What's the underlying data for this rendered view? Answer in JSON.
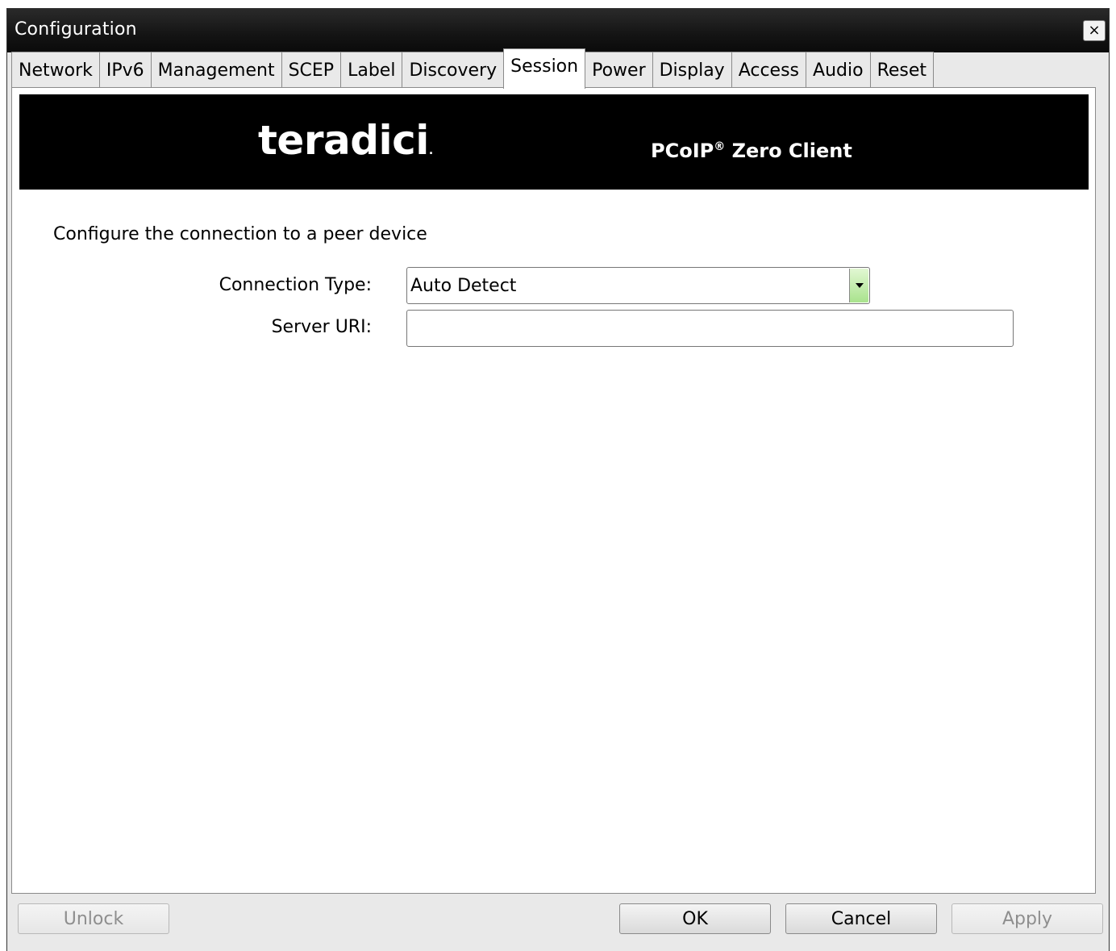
{
  "window": {
    "title": "Configuration",
    "close_glyph": "×"
  },
  "tabs": [
    {
      "label": "Network"
    },
    {
      "label": "IPv6"
    },
    {
      "label": "Management"
    },
    {
      "label": "SCEP"
    },
    {
      "label": "Label"
    },
    {
      "label": "Discovery"
    },
    {
      "label": "Session",
      "active": true
    },
    {
      "label": "Power"
    },
    {
      "label": "Display"
    },
    {
      "label": "Access"
    },
    {
      "label": "Audio"
    },
    {
      "label": "Reset"
    }
  ],
  "banner": {
    "logo_text": "teradici",
    "logo_dot": ".",
    "product_prefix": "PCoIP",
    "product_mark": "®",
    "product_suffix": " Zero Client"
  },
  "session": {
    "description": "Configure the connection to a peer device",
    "connection_type_label": "Connection Type:",
    "connection_type_value": "Auto Detect",
    "server_uri_label": "Server URI:",
    "server_uri_value": ""
  },
  "buttons": {
    "unlock": "Unlock",
    "ok": "OK",
    "cancel": "Cancel",
    "apply": "Apply"
  },
  "colors": {
    "titlebar": "#141414",
    "banner": "#000000",
    "dropdown_accent": "#a9e38d"
  },
  "icons": {
    "close": "close-icon",
    "dropdown": "chevron-down-icon"
  }
}
